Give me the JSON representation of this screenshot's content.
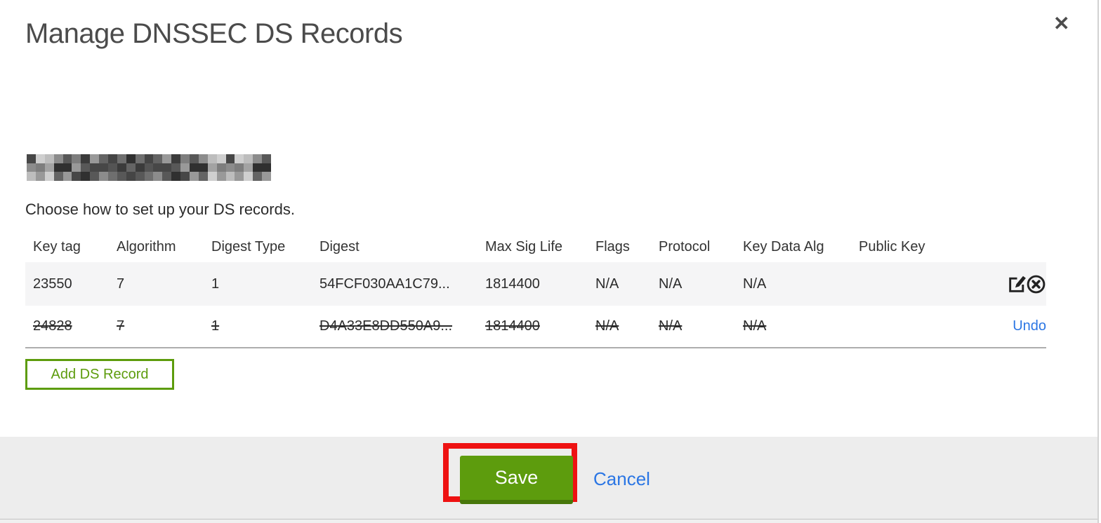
{
  "modal": {
    "title": "Manage DNSSEC DS Records",
    "close_glyph": "✕",
    "subtitle": "Choose how to set up your DS records."
  },
  "table": {
    "headers": [
      "Key tag",
      "Algorithm",
      "Digest Type",
      "Digest",
      "Max Sig Life",
      "Flags",
      "Protocol",
      "Key Data Alg",
      "Public Key"
    ],
    "rows": [
      {
        "key_tag": "23550",
        "algorithm": "7",
        "digest_type": "1",
        "digest": "54FCF030AA1C79...",
        "max_sig_life": "1814400",
        "flags": "N/A",
        "protocol": "N/A",
        "key_data_alg": "N/A",
        "public_key": "",
        "state": "normal"
      },
      {
        "key_tag": "24828",
        "algorithm": "7",
        "digest_type": "1",
        "digest": "D4A33E8DD550A9...",
        "max_sig_life": "1814400",
        "flags": "N/A",
        "protocol": "N/A",
        "key_data_alg": "N/A",
        "public_key": "",
        "state": "deleted",
        "action": "Undo"
      }
    ]
  },
  "buttons": {
    "add_ds_record": "Add DS Record",
    "save": "Save",
    "cancel": "Cancel"
  },
  "colors": {
    "accent_green": "#5d9c0d",
    "accent_green_dark": "#47770a",
    "link_blue": "#2b76e4",
    "annotation_red": "#ee1212"
  }
}
